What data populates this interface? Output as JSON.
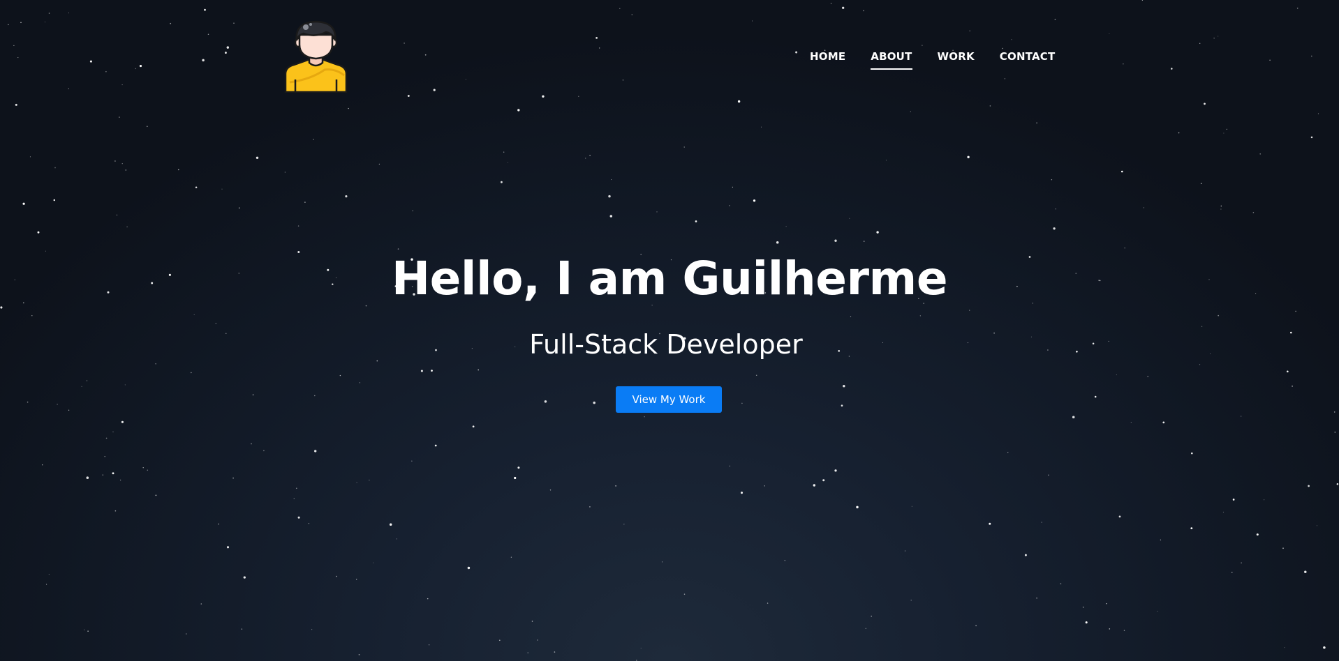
{
  "header": {
    "avatar_icon": "developer-avatar-icon",
    "nav": {
      "items": [
        {
          "label": "HOME",
          "active": false
        },
        {
          "label": "ABOUT",
          "active": true
        },
        {
          "label": "WORK",
          "active": false
        },
        {
          "label": "CONTACT",
          "active": false
        }
      ]
    }
  },
  "hero": {
    "title": "Hello, I am Guilherme",
    "subtitle": "Full-Stack Developer",
    "cta_label": "View My Work"
  },
  "colors": {
    "background_dark": "#0d121b",
    "background_center": "#1e2a3a",
    "accent": "#0a7cf5",
    "text": "#ffffff",
    "avatar_shirt": "#fbc21a",
    "avatar_hair": "#2d2f36",
    "avatar_skin": "#fde0d5"
  }
}
